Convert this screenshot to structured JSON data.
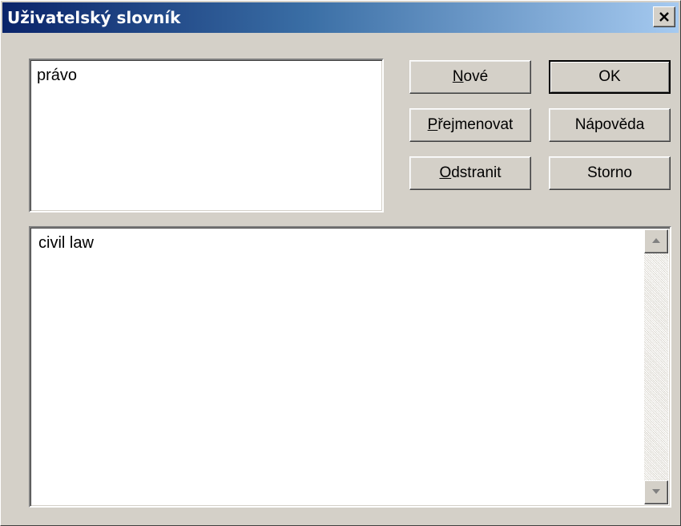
{
  "window": {
    "title": "Uživatelský slovník",
    "close_icon": "close-icon"
  },
  "entries": {
    "items": [
      "právo"
    ]
  },
  "definition": {
    "text": "civil law"
  },
  "buttons": {
    "new": {
      "accel": "N",
      "rest": "ové"
    },
    "rename": {
      "accel": "P",
      "rest": "řejmenovat"
    },
    "delete": {
      "accel": "O",
      "rest": "dstranit"
    },
    "ok": "OK",
    "help": "Nápověda",
    "cancel": "Storno"
  },
  "scrollbar": {
    "up_icon": "arrow-up-icon",
    "down_icon": "arrow-down-icon"
  },
  "colors": {
    "face": "#d4d0c8",
    "titlebar_start": "#0a246a",
    "titlebar_end": "#a6caf0"
  }
}
